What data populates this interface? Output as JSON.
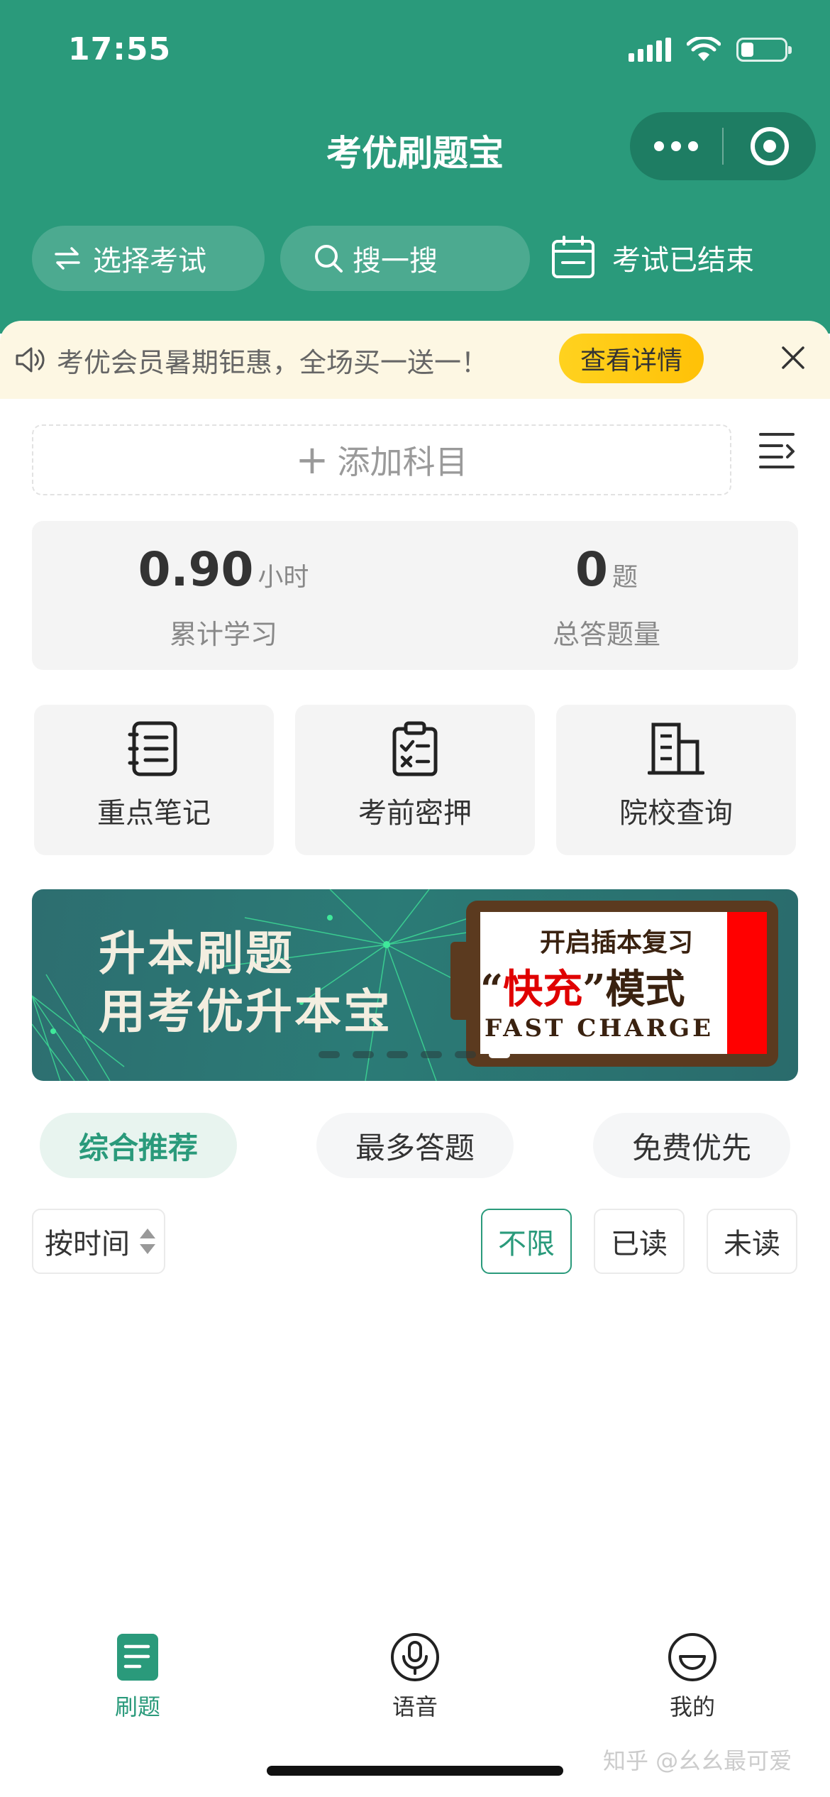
{
  "status_bar": {
    "time": "17:55"
  },
  "header": {
    "title": "考优刷题宝",
    "select_exam": "选择考试",
    "search": "搜一搜",
    "exam_status": "考试已结束"
  },
  "notice": {
    "text": "考优会员暑期钜惠，全场买一送一！",
    "button": "查看详情"
  },
  "add_subject": {
    "plus": "+",
    "label": "添加科目"
  },
  "stats": [
    {
      "value": "0.90",
      "unit": "小时",
      "label": "累计学习"
    },
    {
      "value": "0",
      "unit": "题",
      "label": "总答题量"
    }
  ],
  "quick_actions": [
    {
      "label": "重点笔记",
      "icon": "notebook-icon"
    },
    {
      "label": "考前密押",
      "icon": "checklist-icon"
    },
    {
      "label": "院校查询",
      "icon": "building-icon"
    }
  ],
  "banner": {
    "title_line1": "升本刷题",
    "title_line2": "用考优升本宝",
    "card_top": "开启插本复习",
    "card_quote_open": "“",
    "card_red": "快充",
    "card_quote_close": "”",
    "card_mode": "模式",
    "card_bottom": "FAST CHARGE"
  },
  "filter_tabs": [
    {
      "label": "综合推荐",
      "active": true
    },
    {
      "label": "最多答题",
      "active": false
    },
    {
      "label": "免费优先",
      "active": false
    }
  ],
  "sort": {
    "label": "按时间"
  },
  "read_filters": [
    {
      "label": "不限",
      "active": true
    },
    {
      "label": "已读",
      "active": false
    },
    {
      "label": "未读",
      "active": false
    }
  ],
  "tabbar": [
    {
      "label": "刷题",
      "icon": "practice-icon",
      "active": true
    },
    {
      "label": "语音",
      "icon": "microphone-icon",
      "active": false
    },
    {
      "label": "我的",
      "icon": "profile-icon",
      "active": false
    }
  ],
  "watermark": "知乎 @幺幺最可爱",
  "colors": {
    "primary": "#2a9a7b",
    "notice_bg": "#fdf7e3",
    "notice_button": "#ffc107"
  }
}
